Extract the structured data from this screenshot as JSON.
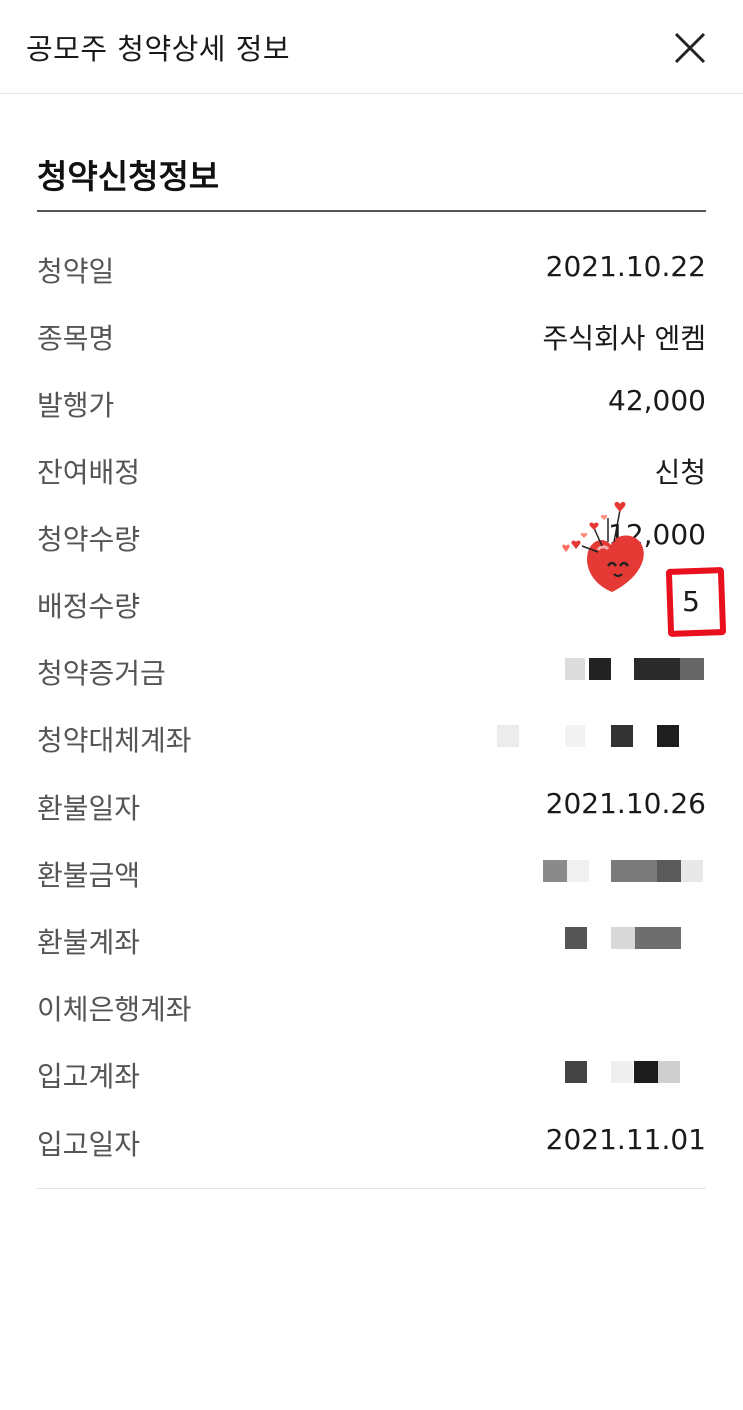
{
  "header": {
    "title": "공모주 청약상세 정보",
    "close_icon": "close-icon"
  },
  "section": {
    "title": "청약신청정보"
  },
  "rows": [
    {
      "label": "청약일",
      "value": "2021.10.22"
    },
    {
      "label": "종목명",
      "value": "주식회사 엔켐"
    },
    {
      "label": "발행가",
      "value": "42,000"
    },
    {
      "label": "잔여배정",
      "value": "신청"
    },
    {
      "label": "청약수량",
      "value": "12,000"
    },
    {
      "label": "배정수량",
      "value": "5"
    },
    {
      "label": "청약증거금",
      "value": ""
    },
    {
      "label": "청약대체계좌",
      "value": ""
    },
    {
      "label": "환불일자",
      "value": "2021.10.26"
    },
    {
      "label": "환불금액",
      "value": ""
    },
    {
      "label": "환불계좌",
      "value": ""
    },
    {
      "label": "이체은행계좌",
      "value": ""
    },
    {
      "label": "입고계좌",
      "value": ""
    },
    {
      "label": "입고일자",
      "value": "2021.11.01"
    }
  ],
  "colors": {
    "highlight": "#e8101c",
    "sticker_heart": "#e53935"
  }
}
